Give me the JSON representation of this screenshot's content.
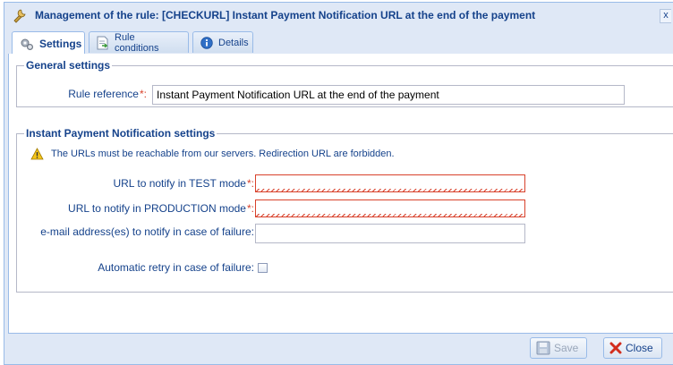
{
  "window": {
    "title": "Management of the rule: [CHECKURL] Instant Payment Notification URL at the end of the payment",
    "close_label": "x"
  },
  "tabs": [
    {
      "label": "Settings",
      "icon": "gear-icon",
      "active": true
    },
    {
      "label": "Rule conditions",
      "icon": "document-arrow-icon",
      "active": false
    },
    {
      "label": "Details",
      "icon": "info-icon",
      "active": false
    }
  ],
  "general": {
    "legend": "General settings",
    "rule_reference_label": "Rule reference",
    "rule_reference_value": "Instant Payment Notification URL at the end of the payment"
  },
  "ipn": {
    "legend": "Instant Payment Notification settings",
    "warning": "The URLs must be reachable from our servers. Redirection URL are forbidden.",
    "test_url_label": "URL to notify in TEST mode",
    "test_url_value": "",
    "prod_url_label": "URL to notify in PRODUCTION mode",
    "prod_url_value": "",
    "email_label": "e-mail address(es) to notify in case of failure:",
    "email_value": "",
    "retry_label": "Automatic retry in case of failure:",
    "retry_checked": false
  },
  "required_marker": "*:",
  "buttons": {
    "save_label": "Save",
    "close_label": "Close"
  },
  "colors": {
    "title_text": "#15428b",
    "required": "#d8412b",
    "window_bg": "#dfe8f6"
  }
}
